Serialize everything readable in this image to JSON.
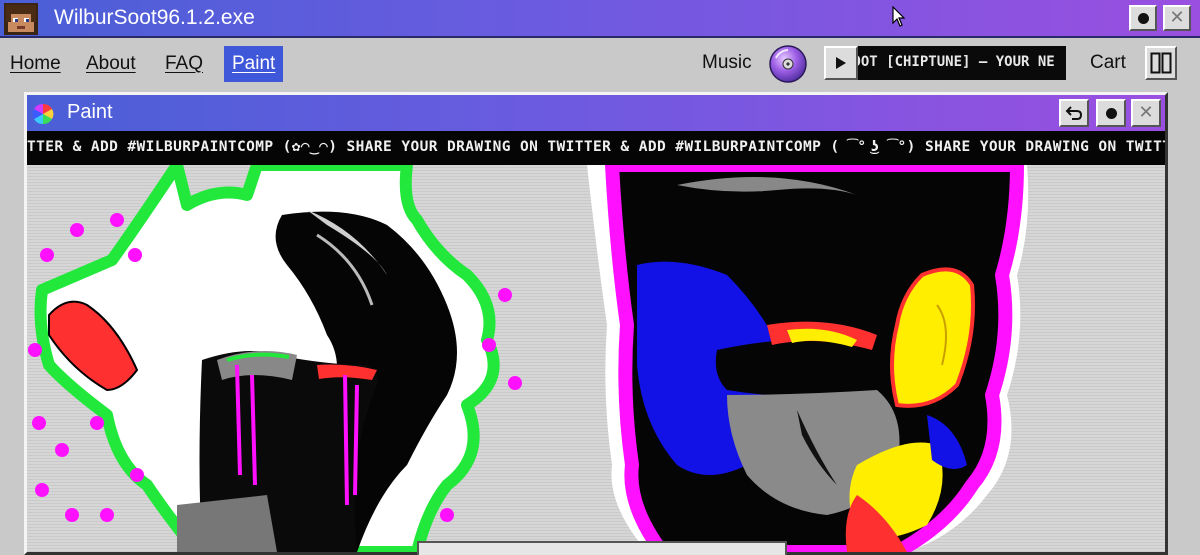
{
  "window": {
    "title": "WilburSoot96.1.2.exe"
  },
  "menu": {
    "items": [
      "Home",
      "About",
      "FAQ",
      "Paint"
    ],
    "active": "Paint"
  },
  "music": {
    "label": "Music",
    "now_playing": "SOOT [CHIPTUNE] — YOUR NE"
  },
  "cart": {
    "label": "Cart",
    "count_glyph": "00"
  },
  "paint_window": {
    "title": "Paint",
    "announcement": "TTER & ADD #WILBURPAINTCOMP (✿◠‿◠) SHARE YOUR DRAWING ON TWITTER & ADD #WILBURPAINTCOMP ( ͡° ͜ʖ ͡°) SHARE YOUR DRAWING ON TWITTER & ADD"
  },
  "icons": {
    "app": "pixel-avatar-icon",
    "cursor": "mouse-cursor-icon",
    "music": "compact-disc-icon",
    "play": "play-icon",
    "paint": "color-wheel-icon",
    "undo": "undo-icon",
    "close": "close-icon"
  },
  "colors": {
    "titlebar_start": "#4a5fd6",
    "titlebar_end": "#9a4fe0",
    "active_menu": "#3f57d9",
    "chrome": "#c9c9c9",
    "drawing_green": "#22e83c",
    "drawing_magenta": "#ff10ff",
    "drawing_blue": "#1212e6",
    "drawing_yellow": "#ffee00",
    "drawing_red": "#ff3030"
  }
}
